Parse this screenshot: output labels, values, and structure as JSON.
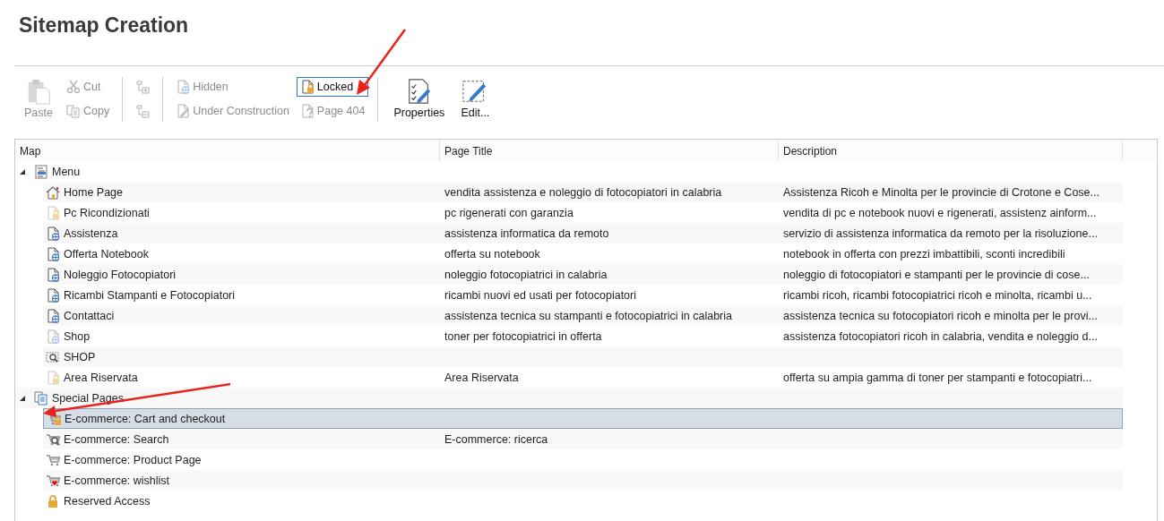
{
  "title": "Sitemap Creation",
  "toolbar": {
    "groups": [
      {
        "columns": [
          [
            {
              "label": "Paste",
              "kind": "paste",
              "disabled": true,
              "focused": false
            }
          ],
          [
            {
              "label": "Cut",
              "kind": "cut",
              "disabled": true,
              "focused": false
            },
            {
              "label": "Copy",
              "kind": "copy",
              "disabled": true,
              "focused": false
            }
          ]
        ]
      },
      {
        "columns": [
          [
            {
              "kind": "indent",
              "disabled": true,
              "focused": false
            },
            {
              "kind": "outdent",
              "disabled": true,
              "focused": false
            }
          ]
        ]
      },
      {
        "columns": [
          [
            {
              "label": "Hidden",
              "kind": "hidden",
              "disabled": true,
              "focused": false
            },
            {
              "label": "Under Construction",
              "kind": "construction",
              "disabled": true,
              "focused": false
            }
          ],
          [
            {
              "label": "Locked",
              "kind": "locked",
              "disabled": false,
              "focused": true
            },
            {
              "label": "Page 404",
              "kind": "page404",
              "disabled": true,
              "focused": false
            }
          ]
        ]
      },
      {
        "columns": [
          [
            {
              "label": "Properties",
              "kind": "properties",
              "disabled": false,
              "focused": false
            }
          ],
          [
            {
              "label": "Edit...",
              "kind": "edit",
              "disabled": false,
              "focused": false
            }
          ]
        ]
      }
    ]
  },
  "columns": [
    "Map",
    "Page Title",
    "Description"
  ],
  "tree": [
    {
      "label": "Menu",
      "kind": "menu",
      "expanded": true,
      "selected": false,
      "children": [
        {
          "label": "Home Page",
          "kind": "home",
          "inactive": false,
          "selected": false,
          "page_title": "vendita assistenza e noleggio di fotocopiatori in calabria",
          "description": "Assistenza Ricoh e Minolta per le provincie di Crotone e Cose..."
        },
        {
          "label": "Pc Ricondizionati",
          "kind": "page-locked",
          "inactive": true,
          "selected": false,
          "page_title": "pc rigenerati con garanzia",
          "description": "vendita di pc e notebook nuovi e rigenerati, assistenz ainform..."
        },
        {
          "label": "Assistenza",
          "kind": "page-web",
          "inactive": false,
          "selected": false,
          "page_title": "assistenza informatica da remoto",
          "description": "servizio di assistenza informatica da remoto per la risoluzione..."
        },
        {
          "label": "Offerta Notebook",
          "kind": "page-web",
          "inactive": false,
          "selected": false,
          "page_title": "offerta su notebook",
          "description": "notebook in offerta con prezzi imbattibili, sconti incredibili"
        },
        {
          "label": "Noleggio Fotocopiatori",
          "kind": "page-web",
          "inactive": false,
          "selected": false,
          "page_title": "noleggio fotocopiatrici in calabria",
          "description": "noleggio di fotocopiatori e stampanti per le provincie di cose..."
        },
        {
          "label": "Ricambi Stampanti e Fotocopiatori",
          "kind": "page-web",
          "inactive": false,
          "selected": false,
          "page_title": "ricambi nuovi ed usati per fotocopiatori",
          "description": "ricambi ricoh, ricambi fotocopiatrici ricoh e minolta, ricambi u..."
        },
        {
          "label": "Contattaci",
          "kind": "page-web",
          "inactive": false,
          "selected": false,
          "page_title": "assistenza tecnica su stampanti e fotocopiatrici in calabria",
          "description": "assistenza tecnica su fotocopiatori ricoh e minolta per le provi..."
        },
        {
          "label": "Shop",
          "kind": "page-web",
          "inactive": true,
          "selected": false,
          "page_title": "toner per fotocopiatrici in offerta",
          "description": "assistenza fotocopiatori ricoh in calabria, vendita e noleggio d..."
        },
        {
          "label": "SHOP",
          "kind": "shop-search",
          "inactive": false,
          "selected": false
        },
        {
          "label": "Area Riservata",
          "kind": "page-locked",
          "inactive": true,
          "selected": false,
          "page_title": "Area Riservata",
          "description": "offerta su ampia gamma di toner per stampanti e fotocopiatri..."
        }
      ]
    },
    {
      "label": "Special Pages",
      "kind": "pages",
      "expanded": true,
      "selected": false,
      "children": [
        {
          "label": "E-commerce: Cart and checkout",
          "kind": "cart-locked",
          "inactive": false,
          "selected": true
        },
        {
          "label": "E-commerce: Search",
          "kind": "cart-search",
          "inactive": false,
          "selected": false,
          "page_title": "E-commerce: ricerca"
        },
        {
          "label": "E-commerce: Product Page",
          "kind": "cart",
          "inactive": false,
          "selected": false
        },
        {
          "label": "E-commerce: wishlist",
          "kind": "cart-heart",
          "inactive": false,
          "selected": false
        },
        {
          "label": "Reserved Access",
          "kind": "lock",
          "inactive": false,
          "selected": false
        }
      ]
    }
  ]
}
